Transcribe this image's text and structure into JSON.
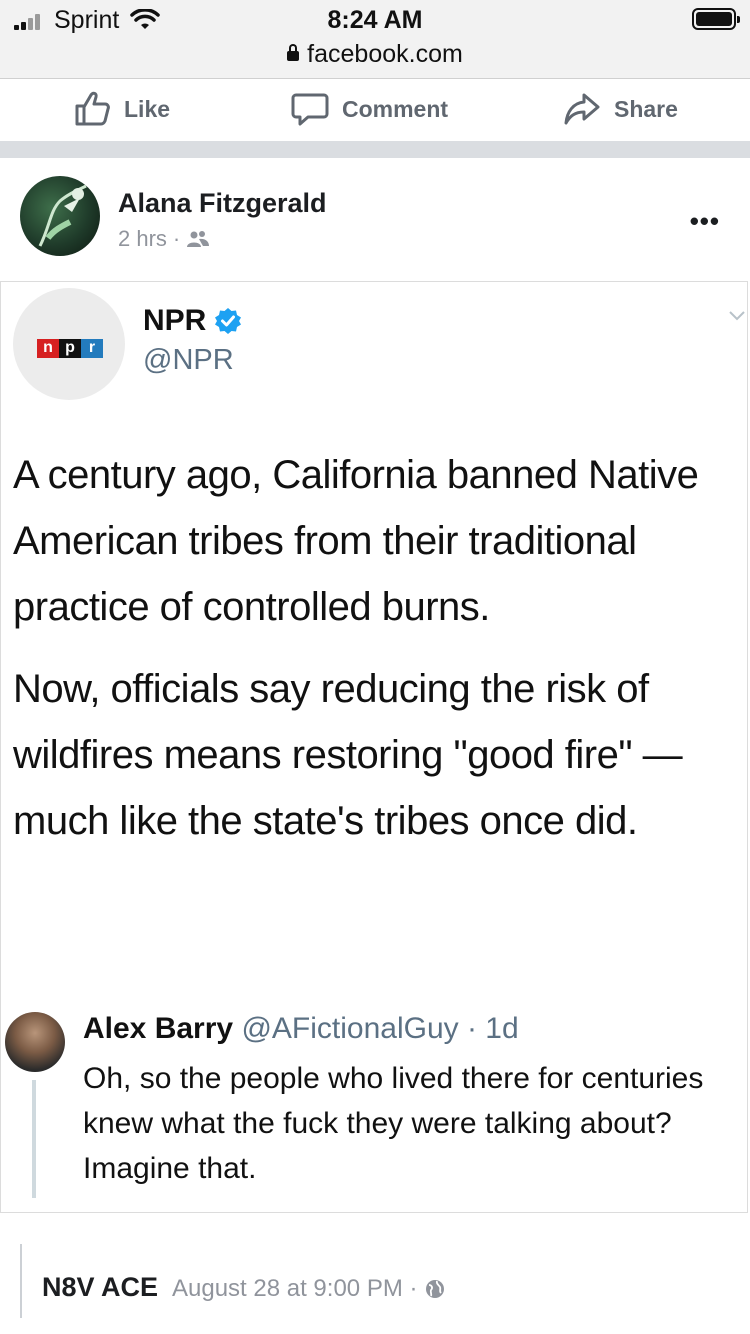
{
  "status_bar": {
    "carrier": "Sprint",
    "time": "8:24 AM",
    "url": "facebook.com"
  },
  "actions": {
    "like": "Like",
    "comment": "Comment",
    "share": "Share"
  },
  "post": {
    "author": "Alana Fitzgerald",
    "time": "2 hrs",
    "separator": "·",
    "privacy_icon": "friends-icon",
    "more_icon": "•••"
  },
  "tweet": {
    "logo_letters": [
      "n",
      "p",
      "r"
    ],
    "name": "NPR",
    "handle": "@NPR",
    "paragraph1": "A century ago, California banned Native American tribes from their traditional practice of controlled burns.",
    "paragraph2": "Now, officials say reducing the risk of wildfires means restoring \"good fire\" — much like the state's tribes once did.",
    "reply": {
      "name": "Alex Barry",
      "handle": "@AFictionalGuy",
      "time": "· 1d",
      "text": "Oh, so the people who lived there for centuries knew what the fuck they were talking about? Imagine that."
    }
  },
  "next_post": {
    "author": "N8V ACE",
    "time": "August 28 at 9:00 PM ·",
    "privacy_icon": "globe-icon"
  },
  "colors": {
    "npr_red": "#d62021",
    "npr_black": "#111111",
    "npr_blue": "#237bbd",
    "verified": "#1da1f2",
    "facebook_gray": "#606770"
  }
}
